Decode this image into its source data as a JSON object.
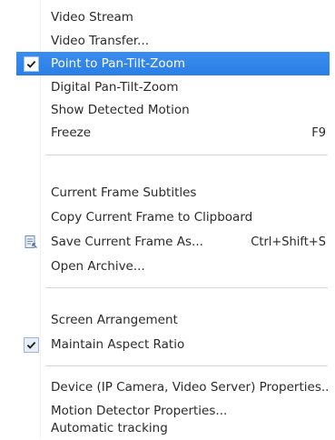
{
  "menu": {
    "items": [
      {
        "label": "Video Stream",
        "shortcut": ""
      },
      {
        "label": "Video Transfer...",
        "shortcut": ""
      },
      {
        "label": "Point to Pan-Tilt-Zoom",
        "shortcut": "",
        "checked": true,
        "highlighted": true
      },
      {
        "label": "Digital Pan-Tilt-Zoom",
        "shortcut": ""
      },
      {
        "label": "Show Detected Motion",
        "shortcut": ""
      },
      {
        "label": "Freeze",
        "shortcut": "F9"
      },
      {
        "label": "Current Frame Subtitles",
        "shortcut": ""
      },
      {
        "label": "Copy Current Frame to Clipboard",
        "shortcut": ""
      },
      {
        "label": "Save Current Frame As...",
        "shortcut": "Ctrl+Shift+S",
        "icon": "save-frame-icon"
      },
      {
        "label": "Open Archive...",
        "shortcut": ""
      },
      {
        "label": "Screen Arrangement",
        "shortcut": ""
      },
      {
        "label": "Maintain Aspect Ratio",
        "shortcut": "",
        "checked": true
      },
      {
        "label": "Device (IP Camera, Video Server) Properties...",
        "shortcut": ""
      },
      {
        "label": "Motion Detector Properties...",
        "shortcut": ""
      },
      {
        "label": "Automatic tracking",
        "shortcut": ""
      }
    ]
  },
  "colors": {
    "highlight": "#2a7fe6",
    "text": "#2a2a2a",
    "separator": "#d7d7d7"
  }
}
